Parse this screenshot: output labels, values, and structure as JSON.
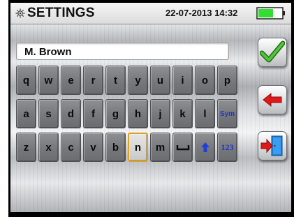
{
  "header": {
    "title": "SETTINGS",
    "datetime": "22-07-2013 14:32",
    "icons": {
      "settings": "gear-icon",
      "battery": "battery-icon"
    }
  },
  "name_field": {
    "value": "M. Brown"
  },
  "keyboard": {
    "rows": [
      [
        "q",
        "w",
        "e",
        "r",
        "t",
        "y",
        "u",
        "i",
        "o",
        "p"
      ],
      [
        "a",
        "s",
        "d",
        "f",
        "g",
        "h",
        "j",
        "k",
        "l",
        "Sym"
      ],
      [
        "z",
        "x",
        "c",
        "v",
        "b",
        "n",
        "m",
        "",
        "",
        "123"
      ]
    ],
    "selected_key": "n",
    "special_icons": {
      "space": "space-icon",
      "shift": "shift-arrow-icon"
    }
  },
  "side_buttons": [
    {
      "name": "confirm-button",
      "icon": "checkmark-icon"
    },
    {
      "name": "backspace-button",
      "icon": "back-arrow-icon"
    },
    {
      "name": "exit-button",
      "icon": "exit-door-icon"
    }
  ],
  "colors": {
    "checkmark": "#3aa62a",
    "arrow_red": "#e01818",
    "door_blue": "#1e7fd6",
    "selected_border": "#e0a020",
    "battery_fill": "#33dd33",
    "blue_key_text": "#2233cc"
  }
}
